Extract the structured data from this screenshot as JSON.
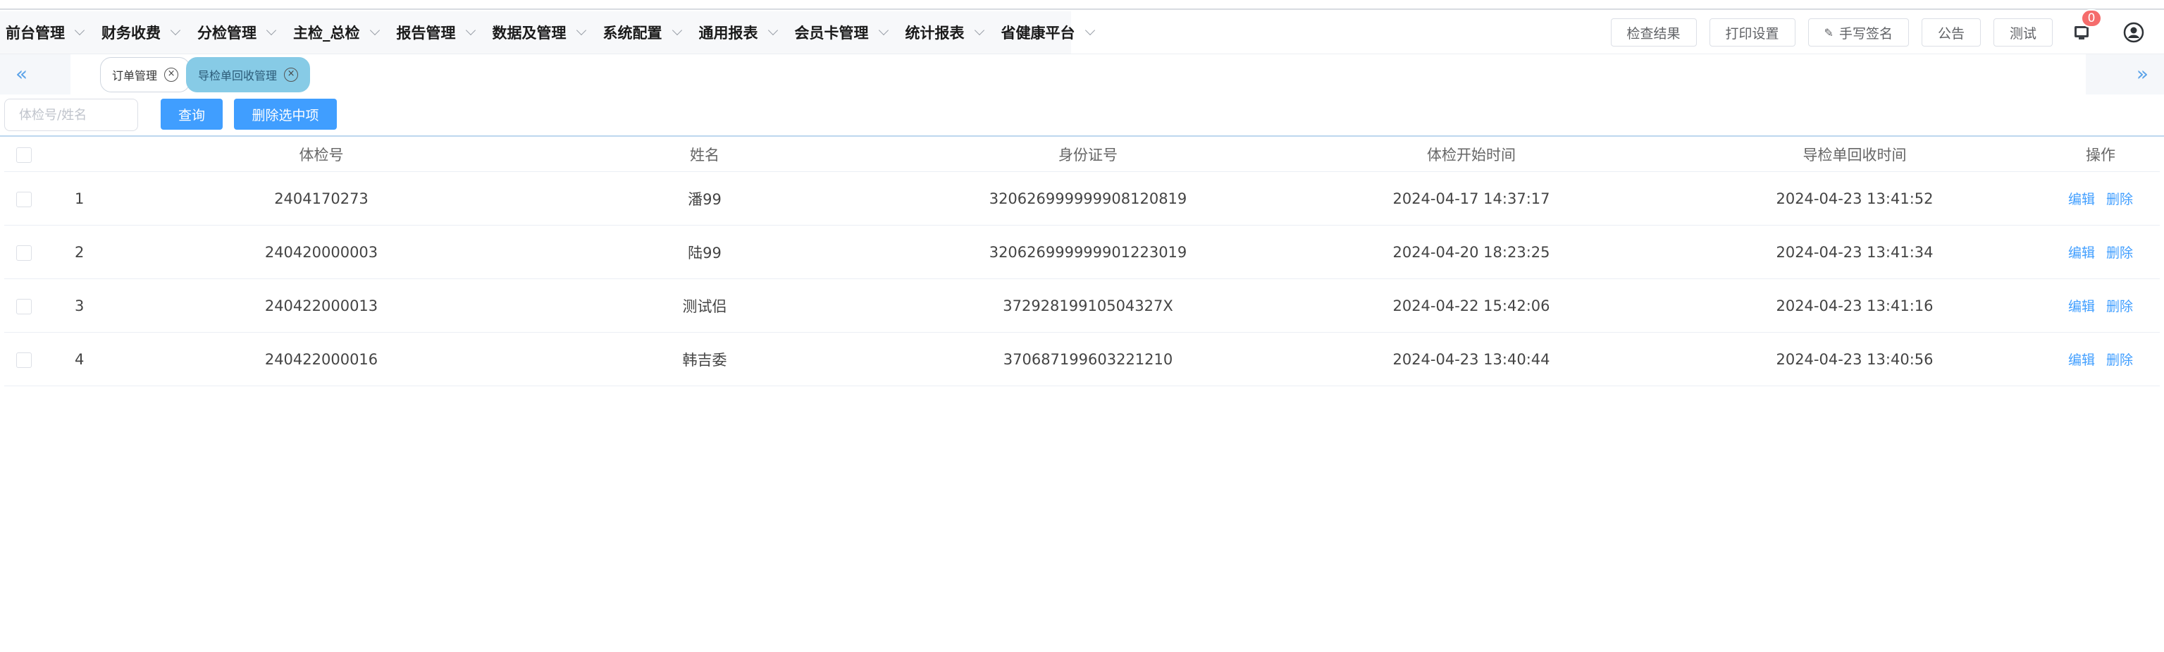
{
  "menu": [
    {
      "label": "前台管理"
    },
    {
      "label": "财务收费"
    },
    {
      "label": "分检管理"
    },
    {
      "label": "主检_总检"
    },
    {
      "label": "报告管理"
    },
    {
      "label": "数据及管理"
    },
    {
      "label": "系统配置"
    },
    {
      "label": "通用报表"
    },
    {
      "label": "会员卡管理"
    },
    {
      "label": "统计报表"
    },
    {
      "label": "省健康平台"
    }
  ],
  "actions": {
    "check_result": "检查结果",
    "print_settings": "打印设置",
    "handwrite_sign": "手写签名",
    "notice": "公告",
    "test": "测试",
    "bell_badge": "0"
  },
  "tabs": [
    {
      "label": "订单管理",
      "active": false
    },
    {
      "label": "导检单回收管理",
      "active": true
    }
  ],
  "search": {
    "placeholder": "体检号/姓名",
    "query_label": "查询",
    "delete_selected_label": "删除选中项"
  },
  "table": {
    "columns": [
      "体检号",
      "姓名",
      "身份证号",
      "体检开始时间",
      "导检单回收时间",
      "操作"
    ],
    "rows": [
      {
        "idx": "1",
        "no": "2404170273",
        "name": "潘99",
        "idcard": "320626999999908120819",
        "start": "2024-04-17 14:37:17",
        "recv": "2024-04-23 13:41:52"
      },
      {
        "idx": "2",
        "no": "240420000003",
        "name": "陆99",
        "idcard": "320626999999901223019",
        "start": "2024-04-20 18:23:25",
        "recv": "2024-04-23 13:41:34"
      },
      {
        "idx": "3",
        "no": "240422000013",
        "name": "测试侣",
        "idcard": "37292819910504327X",
        "start": "2024-04-22 15:42:06",
        "recv": "2024-04-23 13:41:16"
      },
      {
        "idx": "4",
        "no": "240422000016",
        "name": "韩吉委",
        "idcard": "370687199603221210",
        "start": "2024-04-23 13:40:44",
        "recv": "2024-04-23 13:40:56"
      }
    ],
    "edit_label": "编辑",
    "delete_label": "删除"
  },
  "colors": {
    "primary": "#409eff",
    "active_tab": "#87cbe6",
    "badge": "#f56c6c"
  }
}
